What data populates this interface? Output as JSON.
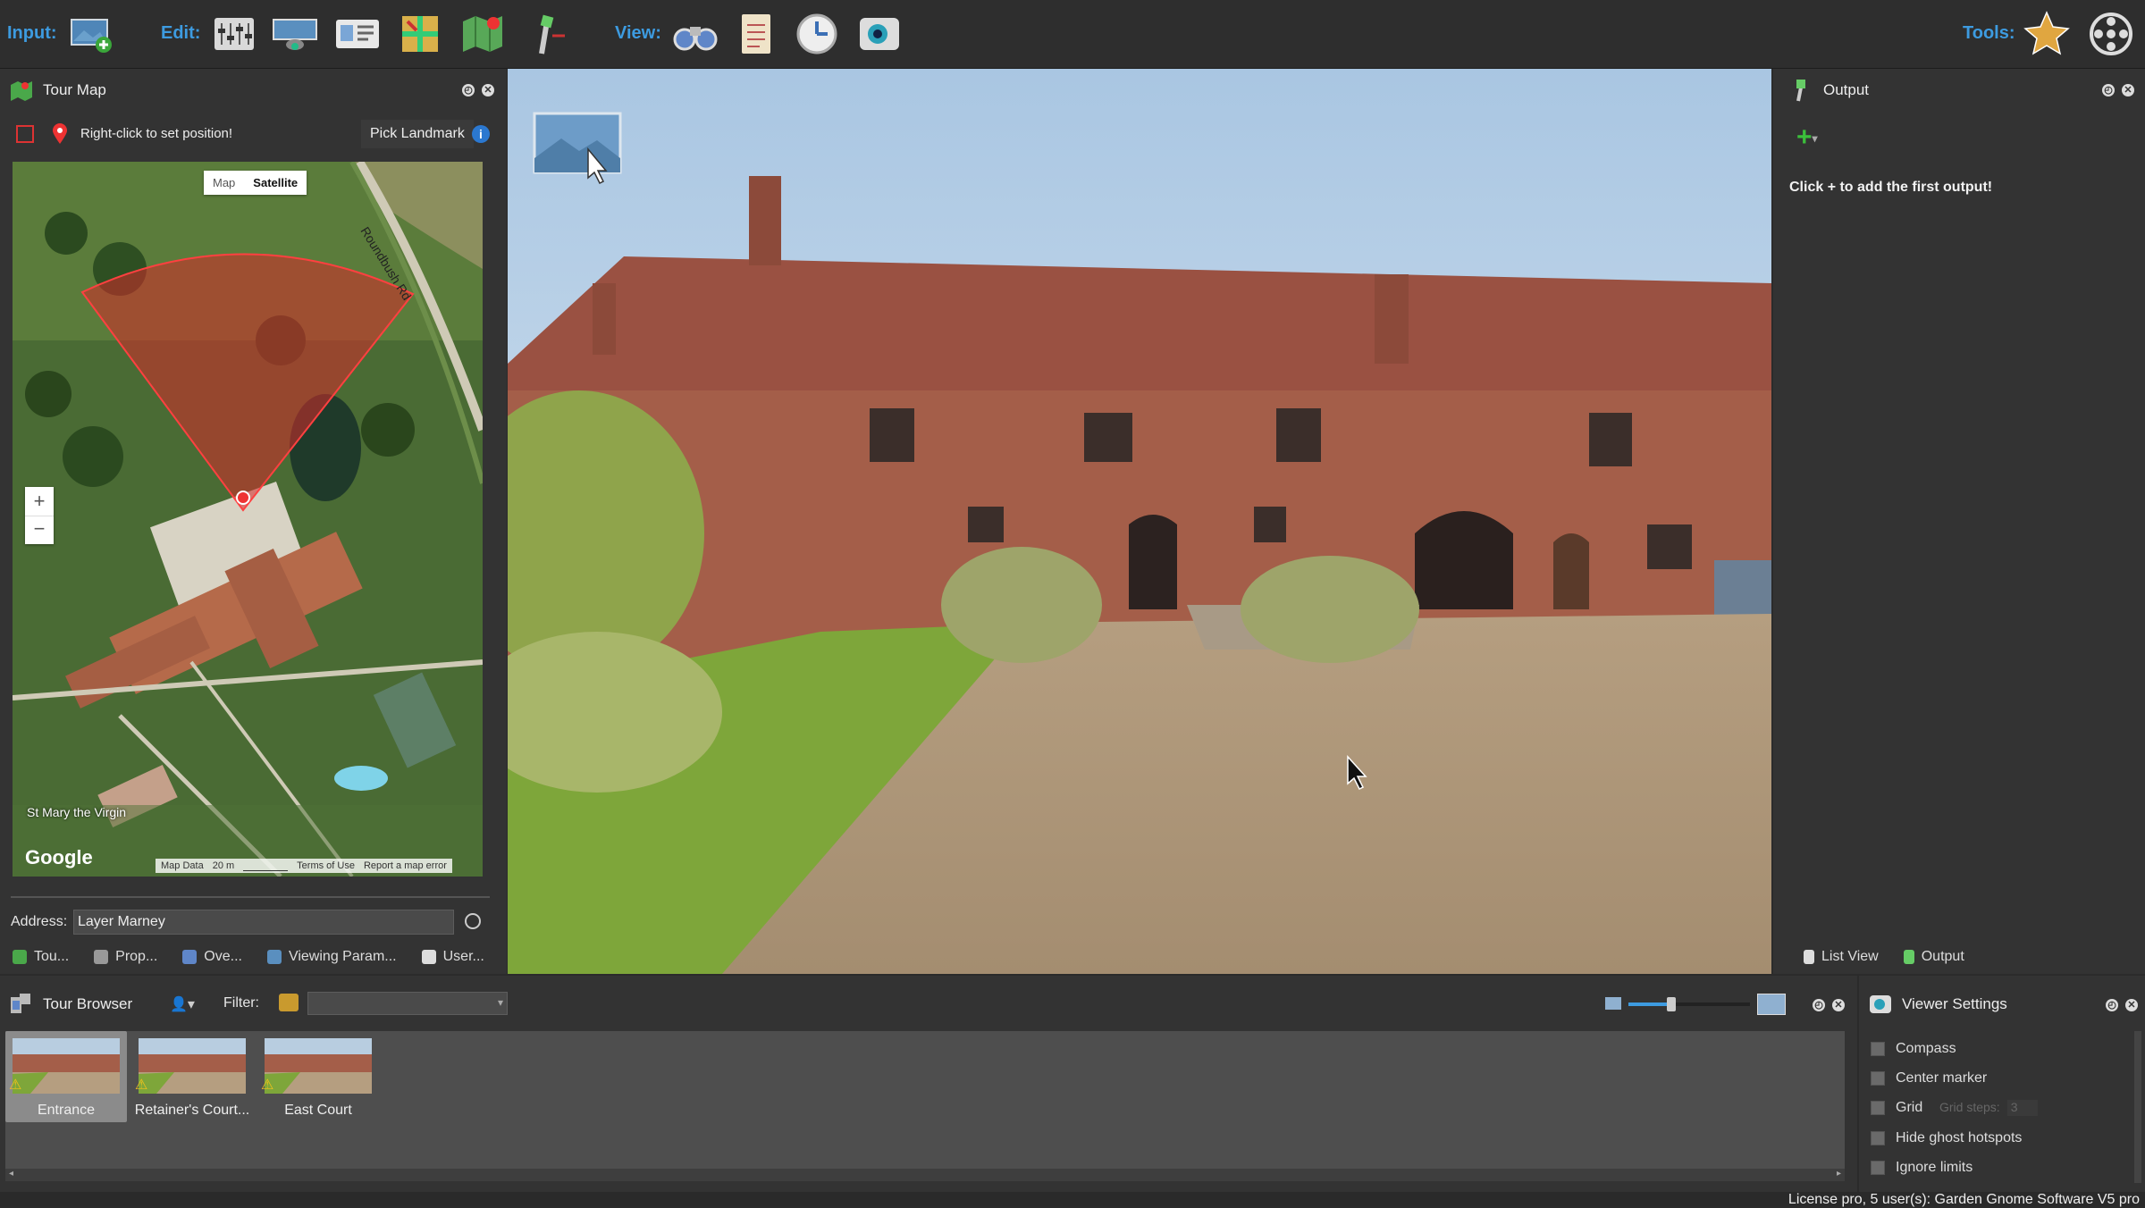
{
  "toolbar": {
    "input_label": "Input:",
    "edit_label": "Edit:",
    "view_label": "View:",
    "tools_label": "Tools:",
    "buttons": [
      "add-panorama-icon",
      "properties-sliders-icon",
      "projection-icon",
      "user-data-card-icon",
      "patch-tool-icon",
      "map-landmark-icon",
      "hotspot-wand-icon",
      "binoculars-icon",
      "notes-icon",
      "preview-clock-icon",
      "eye-viewer-icon",
      "tools-star-icon",
      "film-reel-icon"
    ]
  },
  "tour_map": {
    "title": "Tour Map",
    "hint": "Right-click to set position!",
    "pick_landmark": "Pick Landmark",
    "map_btn": "Map",
    "satellite_btn": "Satellite",
    "road_label": "Roundbush Rd",
    "place_label": "St Mary the Virgin",
    "google": "Google",
    "map_data": "Map Data",
    "scale": "20 m",
    "terms": "Terms of Use",
    "report": "Report a map error",
    "address_label": "Address:",
    "address_value": "Layer Marney",
    "tabs": [
      "Tou...",
      "Prop...",
      "Ove...",
      "Viewing Param...",
      "User..."
    ]
  },
  "output": {
    "title": "Output",
    "hint": "Click + to add the first output!",
    "tabs": [
      "List View",
      "Output"
    ]
  },
  "tour_browser": {
    "title": "Tour Browser",
    "filter_label": "Filter:",
    "filter_value": "",
    "items": [
      {
        "label": "Entrance",
        "selected": true
      },
      {
        "label": "Retainer's Court...",
        "selected": false
      },
      {
        "label": "East Court",
        "selected": false
      }
    ],
    "zoom_level": 0.35
  },
  "viewer_settings": {
    "title": "Viewer Settings",
    "options": [
      {
        "label": "Compass",
        "checked": false
      },
      {
        "label": "Center marker",
        "checked": false
      },
      {
        "label": "Grid",
        "checked": false
      },
      {
        "label": "Hide ghost hotspots",
        "checked": false
      },
      {
        "label": "Ignore limits",
        "checked": false
      }
    ],
    "grid_steps_label": "Grid steps:",
    "grid_steps_value": "3"
  },
  "status": {
    "license": "License pro, 5 user(s): Garden Gnome Software V5 pro"
  },
  "colors": {
    "accent": "#3d9be0",
    "panel": "#333333",
    "fov_cone": "#d62a2a"
  }
}
